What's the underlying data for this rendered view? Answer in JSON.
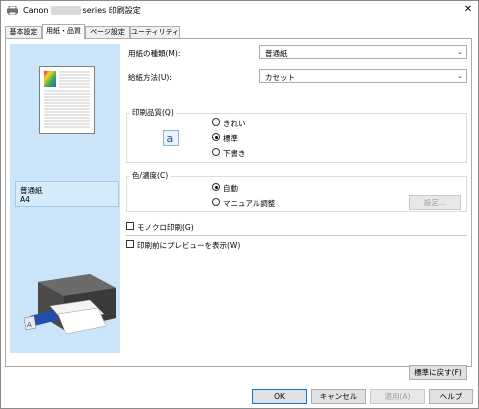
{
  "window": {
    "title_prefix": "Canon",
    "title_suffix": "series 印刷設定"
  },
  "tabs": [
    {
      "label": "基本設定"
    },
    {
      "label": "用紙・品質"
    },
    {
      "label": "ページ設定"
    },
    {
      "label": "ユーティリティ"
    }
  ],
  "preview": {
    "media_type": "普通紙",
    "page_size": "A4"
  },
  "media_type": {
    "label": "用紙の種類(M):",
    "value": "普通紙"
  },
  "paper_source": {
    "label": "給紙方法(U):",
    "value": "カセット"
  },
  "print_quality": {
    "title": "印刷品質(Q)",
    "icon_letter": "a",
    "options": [
      {
        "label": "きれい",
        "selected": false
      },
      {
        "label": "標準",
        "selected": true
      },
      {
        "label": "下書き",
        "selected": false
      }
    ]
  },
  "color_intensity": {
    "title": "色/濃度(C)",
    "options": [
      {
        "label": "自動",
        "selected": true
      },
      {
        "label": "マニュアル調整",
        "selected": false
      }
    ],
    "set_button": "設定..."
  },
  "grayscale": {
    "label": "モノクロ印刷(G)",
    "checked": false
  },
  "preview_before_print": {
    "label": "印刷前にプレビューを表示(W)",
    "checked": false
  },
  "defaults_button": "標準に戻す(F)",
  "footer": {
    "ok": "OK",
    "cancel": "キャンセル",
    "apply": "適用(A)",
    "help": "ヘルプ"
  },
  "colors": {
    "preview_bg": "#cce4f7",
    "accent": "#0078d7"
  }
}
